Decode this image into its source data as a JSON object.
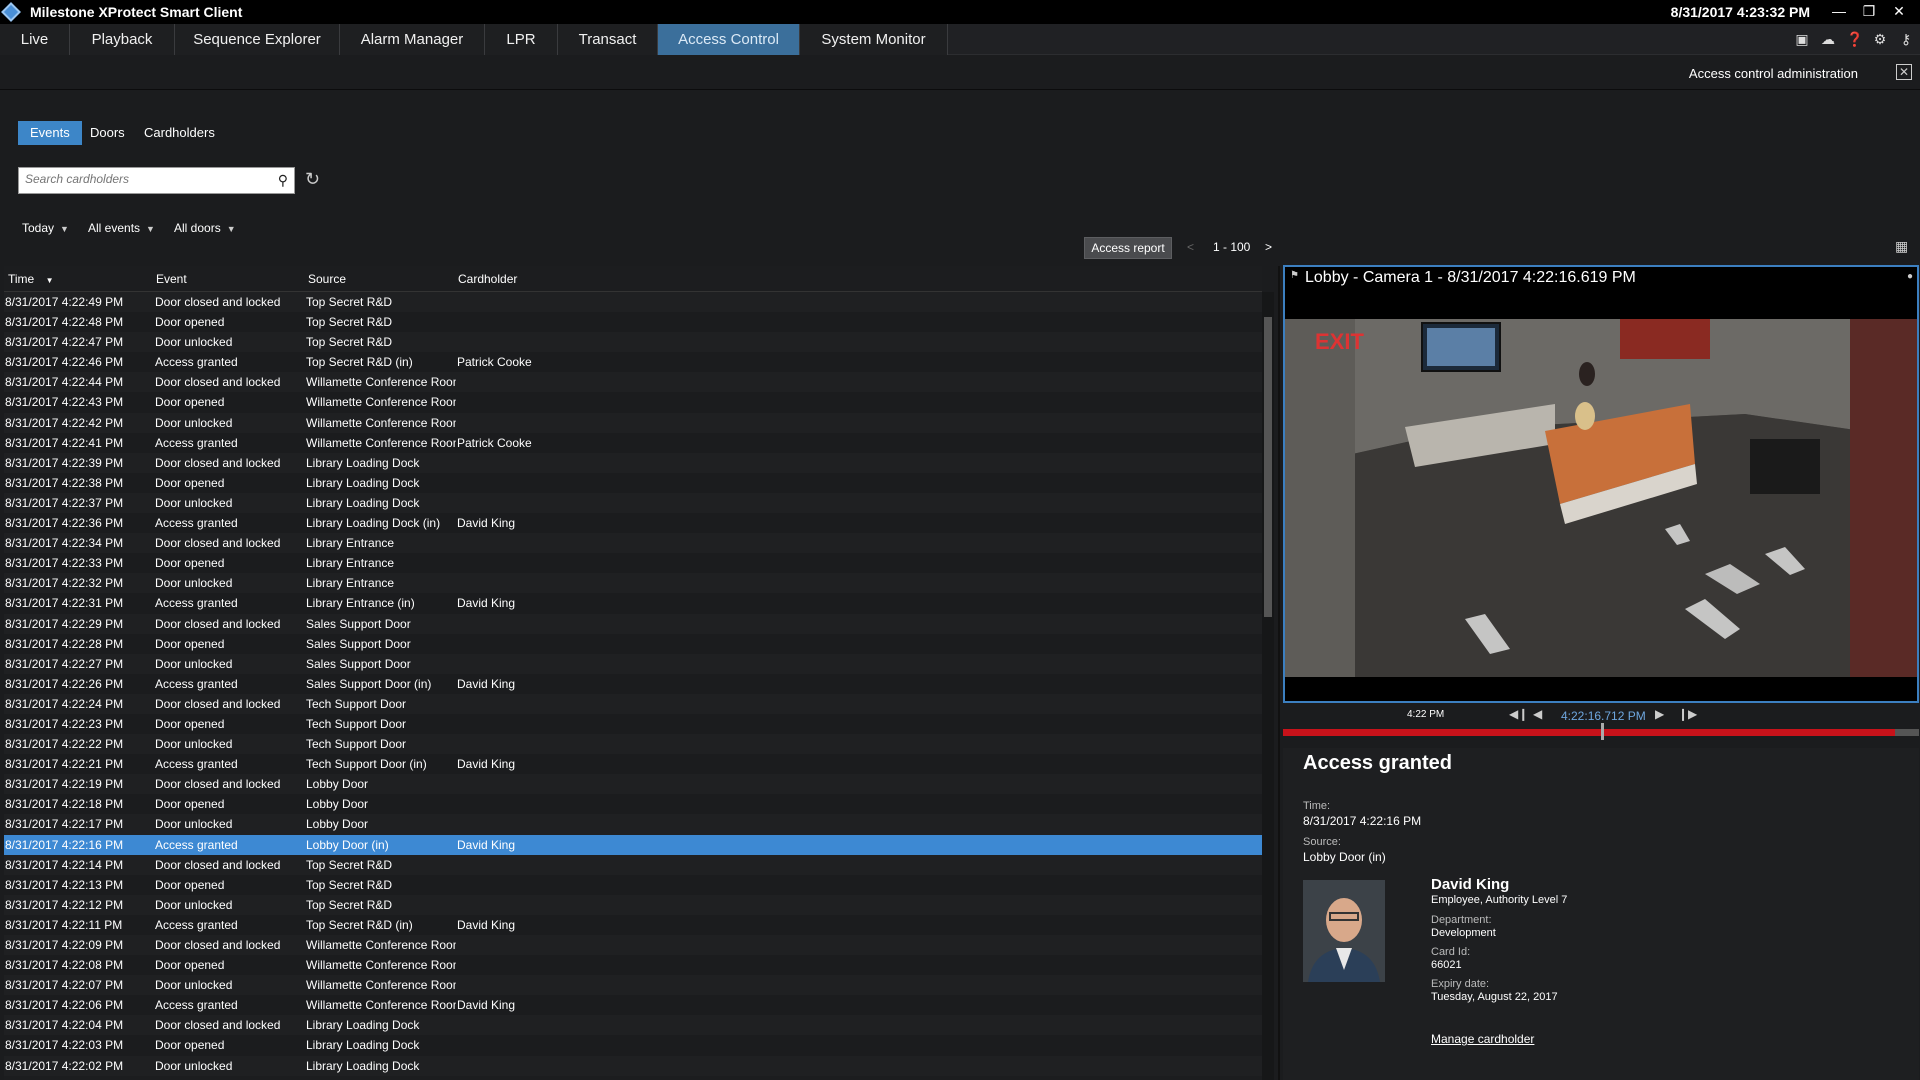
{
  "app": {
    "title": "Milestone XProtect Smart Client",
    "clock": "8/31/2017 4:23:32 PM"
  },
  "tabs": [
    "Live",
    "Playback",
    "Sequence Explorer",
    "Alarm Manager",
    "LPR",
    "Transact",
    "Access Control",
    "System Monitor"
  ],
  "active_tab": "Access Control",
  "subheader": {
    "admin_label": "Access control administration"
  },
  "subtabs": [
    "Events",
    "Doors",
    "Cardholders"
  ],
  "search": {
    "placeholder": "Search cardholders"
  },
  "filters": {
    "date": "Today",
    "events": "All events",
    "doors": "All doors"
  },
  "toolbar": {
    "report_label": "Access report",
    "prev": "<",
    "range": "1 - 100",
    "next": ">"
  },
  "columns": {
    "time": "Time",
    "event": "Event",
    "source": "Source",
    "cardholder": "Cardholder"
  },
  "rows": [
    {
      "time": "8/31/2017 4:22:49 PM",
      "event": "Door closed and locked",
      "source": "Top Secret R&D",
      "cardholder": ""
    },
    {
      "time": "8/31/2017 4:22:48 PM",
      "event": "Door opened",
      "source": "Top Secret R&D",
      "cardholder": ""
    },
    {
      "time": "8/31/2017 4:22:47 PM",
      "event": "Door unlocked",
      "source": "Top Secret R&D",
      "cardholder": ""
    },
    {
      "time": "8/31/2017 4:22:46 PM",
      "event": "Access granted",
      "source": "Top Secret R&D (in)",
      "cardholder": "Patrick Cooke"
    },
    {
      "time": "8/31/2017 4:22:44 PM",
      "event": "Door closed and locked",
      "source": "Willamette Conference Room",
      "cardholder": ""
    },
    {
      "time": "8/31/2017 4:22:43 PM",
      "event": "Door opened",
      "source": "Willamette Conference Room",
      "cardholder": ""
    },
    {
      "time": "8/31/2017 4:22:42 PM",
      "event": "Door unlocked",
      "source": "Willamette Conference Room",
      "cardholder": ""
    },
    {
      "time": "8/31/2017 4:22:41 PM",
      "event": "Access granted",
      "source": "Willamette Conference Room",
      "cardholder": "Patrick Cooke"
    },
    {
      "time": "8/31/2017 4:22:39 PM",
      "event": "Door closed and locked",
      "source": "Library Loading Dock",
      "cardholder": ""
    },
    {
      "time": "8/31/2017 4:22:38 PM",
      "event": "Door opened",
      "source": "Library Loading Dock",
      "cardholder": ""
    },
    {
      "time": "8/31/2017 4:22:37 PM",
      "event": "Door unlocked",
      "source": "Library Loading Dock",
      "cardholder": ""
    },
    {
      "time": "8/31/2017 4:22:36 PM",
      "event": "Access granted",
      "source": "Library Loading Dock (in)",
      "cardholder": "David King"
    },
    {
      "time": "8/31/2017 4:22:34 PM",
      "event": "Door closed and locked",
      "source": "Library Entrance",
      "cardholder": ""
    },
    {
      "time": "8/31/2017 4:22:33 PM",
      "event": "Door opened",
      "source": "Library Entrance",
      "cardholder": ""
    },
    {
      "time": "8/31/2017 4:22:32 PM",
      "event": "Door unlocked",
      "source": "Library Entrance",
      "cardholder": ""
    },
    {
      "time": "8/31/2017 4:22:31 PM",
      "event": "Access granted",
      "source": "Library Entrance (in)",
      "cardholder": "David King"
    },
    {
      "time": "8/31/2017 4:22:29 PM",
      "event": "Door closed and locked",
      "source": "Sales Support Door",
      "cardholder": ""
    },
    {
      "time": "8/31/2017 4:22:28 PM",
      "event": "Door opened",
      "source": "Sales Support Door",
      "cardholder": ""
    },
    {
      "time": "8/31/2017 4:22:27 PM",
      "event": "Door unlocked",
      "source": "Sales Support Door",
      "cardholder": ""
    },
    {
      "time": "8/31/2017 4:22:26 PM",
      "event": "Access granted",
      "source": "Sales Support Door (in)",
      "cardholder": "David King"
    },
    {
      "time": "8/31/2017 4:22:24 PM",
      "event": "Door closed and locked",
      "source": "Tech Support Door",
      "cardholder": ""
    },
    {
      "time": "8/31/2017 4:22:23 PM",
      "event": "Door opened",
      "source": "Tech Support Door",
      "cardholder": ""
    },
    {
      "time": "8/31/2017 4:22:22 PM",
      "event": "Door unlocked",
      "source": "Tech Support Door",
      "cardholder": ""
    },
    {
      "time": "8/31/2017 4:22:21 PM",
      "event": "Access granted",
      "source": "Tech Support Door (in)",
      "cardholder": "David King"
    },
    {
      "time": "8/31/2017 4:22:19 PM",
      "event": "Door closed and locked",
      "source": "Lobby Door",
      "cardholder": ""
    },
    {
      "time": "8/31/2017 4:22:18 PM",
      "event": "Door opened",
      "source": "Lobby Door",
      "cardholder": ""
    },
    {
      "time": "8/31/2017 4:22:17 PM",
      "event": "Door unlocked",
      "source": "Lobby Door",
      "cardholder": ""
    },
    {
      "time": "8/31/2017 4:22:16 PM",
      "event": "Access granted",
      "source": "Lobby Door (in)",
      "cardholder": "David King"
    },
    {
      "time": "8/31/2017 4:22:14 PM",
      "event": "Door closed and locked",
      "source": "Top Secret R&D",
      "cardholder": ""
    },
    {
      "time": "8/31/2017 4:22:13 PM",
      "event": "Door opened",
      "source": "Top Secret R&D",
      "cardholder": ""
    },
    {
      "time": "8/31/2017 4:22:12 PM",
      "event": "Door unlocked",
      "source": "Top Secret R&D",
      "cardholder": ""
    },
    {
      "time": "8/31/2017 4:22:11 PM",
      "event": "Access granted",
      "source": "Top Secret R&D (in)",
      "cardholder": "David King"
    },
    {
      "time": "8/31/2017 4:22:09 PM",
      "event": "Door closed and locked",
      "source": "Willamette Conference Room",
      "cardholder": ""
    },
    {
      "time": "8/31/2017 4:22:08 PM",
      "event": "Door opened",
      "source": "Willamette Conference Room",
      "cardholder": ""
    },
    {
      "time": "8/31/2017 4:22:07 PM",
      "event": "Door unlocked",
      "source": "Willamette Conference Room",
      "cardholder": ""
    },
    {
      "time": "8/31/2017 4:22:06 PM",
      "event": "Access granted",
      "source": "Willamette Conference Room",
      "cardholder": "David King"
    },
    {
      "time": "8/31/2017 4:22:04 PM",
      "event": "Door closed and locked",
      "source": "Library Loading Dock",
      "cardholder": ""
    },
    {
      "time": "8/31/2017 4:22:03 PM",
      "event": "Door opened",
      "source": "Library Loading Dock",
      "cardholder": ""
    },
    {
      "time": "8/31/2017 4:22:02 PM",
      "event": "Door unlocked",
      "source": "Library Loading Dock",
      "cardholder": ""
    }
  ],
  "selected_row": 27,
  "video": {
    "title": "Lobby - Camera 1 - 8/31/2017 4:22:16.619 PM",
    "exit_sign": "EXIT",
    "timeline_label": "4:22 PM",
    "current_time": "4:22:16.712 PM"
  },
  "details": {
    "title": "Access granted",
    "time_label": "Time:",
    "time": "8/31/2017 4:22:16 PM",
    "source_label": "Source:",
    "source": "Lobby Door (in)",
    "name": "David King",
    "role": "Employee, Authority Level 7",
    "department_label": "Department:",
    "department": "Development",
    "card_label": "Card Id:",
    "card_id": "66021",
    "expiry_label": "Expiry date:",
    "expiry": "Tuesday, August 22, 2017",
    "manage_link": "Manage cardholder"
  }
}
